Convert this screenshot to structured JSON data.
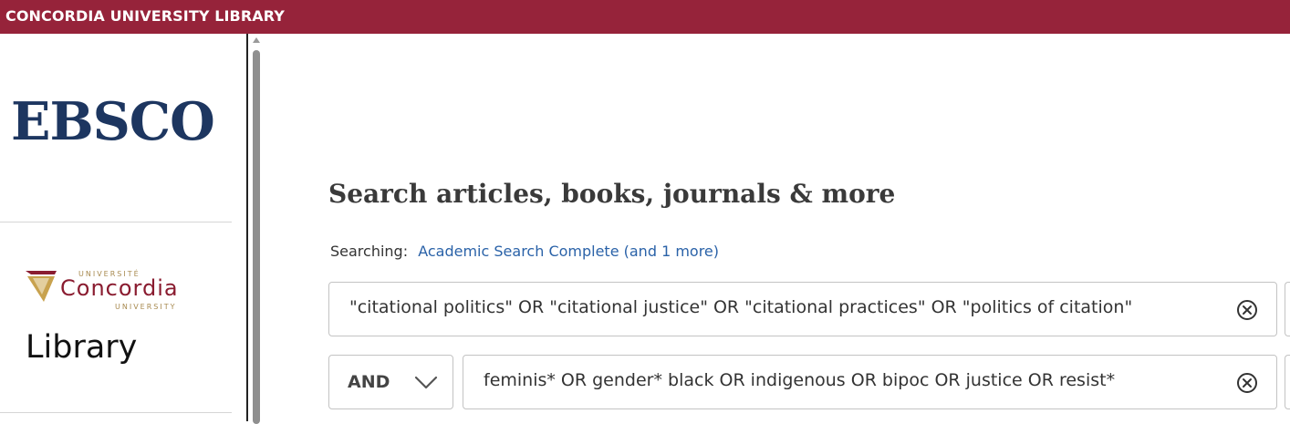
{
  "header": {
    "title": "CONCORDIA UNIVERSITY LIBRARY",
    "background_color": "#96233a"
  },
  "sidebar": {
    "ebsco_logo_text": "EBSCO",
    "concordia_logo": {
      "top_text": "UNIVERSITÉ",
      "main_text": "Concordia",
      "bottom_text": "UNIVERSITY"
    },
    "library_label": "Library"
  },
  "main": {
    "title": "Search articles, books, journals & more",
    "searching_label": "Searching:",
    "searching_link": "Academic Search Complete (and 1 more)",
    "search_rows": [
      {
        "value": "\"citational politics\" OR \"citational justice\" OR \"citational practices\" OR \"politics of citation\"",
        "clear_icon": "clear-circle-x-icon"
      },
      {
        "operator": "AND",
        "operator_icon": "chevron-down-icon",
        "value": "feminis* OR  gender* black OR indigenous OR bipoc OR justice OR resist*",
        "clear_icon": "clear-circle-x-icon"
      }
    ]
  },
  "colors": {
    "brand_maroon": "#96233a",
    "ebsco_navy": "#1d3660",
    "link_blue": "#2a62a8",
    "concordia_gold": "#c8a24e"
  }
}
